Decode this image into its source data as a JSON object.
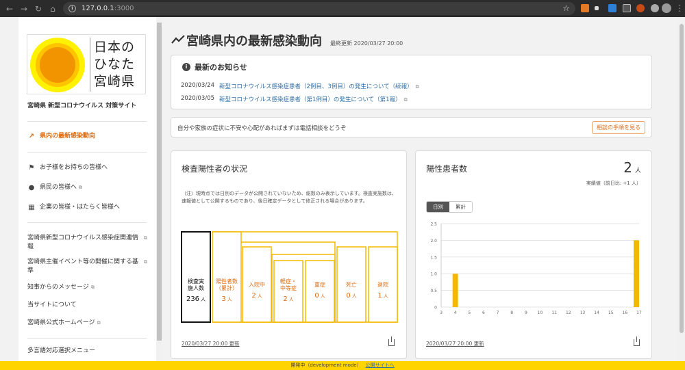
{
  "browser": {
    "url_host": "127.0.0.1",
    "url_port": ":3000"
  },
  "sidebar": {
    "logo_text": "日本のひなた宮崎県",
    "site_title": "宮崎県 新型コロナウイルス 対策サイト",
    "items": [
      {
        "label": "県内の最新感染動向",
        "icon": "trend-icon"
      },
      {
        "label": "お子様をお持ちの皆様へ",
        "icon": "parent-child-icon"
      },
      {
        "label": "県民の皆様へ",
        "icon": "people-icon"
      },
      {
        "label": "企業の皆様・はたらく皆様へ",
        "icon": "building-icon"
      },
      {
        "label": "宮崎県新型コロナウイルス感染症関連情報",
        "icon": "external-link-icon"
      },
      {
        "label": "宮崎県主催イベント等の開催に関する基準",
        "icon": "external-link-icon"
      },
      {
        "label": "知事からのメッセージ",
        "icon": "external-link-icon"
      },
      {
        "label": "当サイトについて",
        "icon": ""
      },
      {
        "label": "宮崎県公式ホームページ",
        "icon": "external-link-icon"
      },
      {
        "label": "多言語対応選択メニュー",
        "icon": ""
      }
    ]
  },
  "header": {
    "title": "宮崎県内の最新感染動向",
    "updated": "最終更新 2020/03/27 20:00"
  },
  "news": {
    "heading": "最新のお知らせ",
    "items": [
      {
        "date": "2020/03/24",
        "text": "新型コロナウイルス感染症患者（2例目、3例目）の発生について（続報）"
      },
      {
        "date": "2020/03/05",
        "text": "新型コロナウイルス感染症患者（第1例目）の発生について（第1報）"
      }
    ]
  },
  "consult": {
    "text": "自分や家族の症状に不安や心配があればまずは電話相談をどうぞ",
    "button": "相談の手順を見る"
  },
  "test_card": {
    "title": "検査陽性者の状況",
    "note": "（注）現時点では日別のデータが公開されていないため、総数のみ表示しています。検査実施数は、速報値として公開するものであり、後日確定データとして修正される場合があります。",
    "boxes": [
      {
        "label": "検査実施人数",
        "value": "236",
        "unit": "人"
      },
      {
        "label": "陽性者数（累計）",
        "value": "3",
        "unit": "人"
      },
      {
        "label": "入院中",
        "value": "2",
        "unit": "人"
      },
      {
        "label": "軽症・中等症",
        "value": "2",
        "unit": "人"
      },
      {
        "label": "重症",
        "value": "0",
        "unit": "人"
      },
      {
        "label": "死亡",
        "value": "0",
        "unit": "人"
      },
      {
        "label": "退院",
        "value": "1",
        "unit": "人"
      }
    ],
    "updated": "2020/03/27 20:00 更新"
  },
  "positive_card": {
    "title": "陽性患者数",
    "total": "2",
    "unit": "人",
    "sub": "実績値（前日比: +1 人）",
    "toggle_on": "日別",
    "toggle_off": "累計",
    "updated": "2020/03/27 20:00 更新"
  },
  "chart_data": {
    "type": "bar",
    "categories": [
      "3",
      "4",
      "5",
      "6",
      "7",
      "8",
      "9",
      "10",
      "11",
      "12",
      "13",
      "14",
      "15",
      "16",
      "17"
    ],
    "values": [
      0,
      1,
      0,
      0,
      0,
      0,
      0,
      0,
      0,
      0,
      0,
      0,
      0,
      0,
      2
    ],
    "ylim": [
      0,
      2.5
    ],
    "yticks": [
      "0",
      "0.5",
      "1.0",
      "1.5",
      "2.0",
      "2.5"
    ],
    "grid": true,
    "color": "#f5b800"
  },
  "dev_bar": {
    "text": "開発中（development mode）",
    "link": "公開サイトへ"
  },
  "colors": {
    "accent": "#d96b12",
    "chart_yellow": "#f5b800",
    "dev_bar": "#ffd400"
  }
}
